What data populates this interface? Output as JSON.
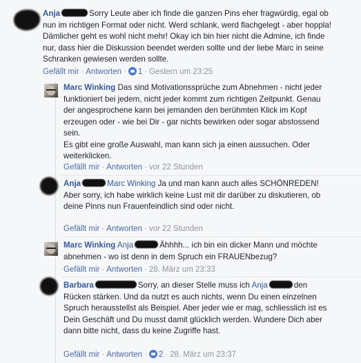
{
  "comments": [
    {
      "author": "Anja",
      "text": "Sorry Leute aber ich finde die ganzen Pins eher fragwürdig, egal ob nun im richtigen Format oder nicht. Werd schlank, werd flachgelegt - aber hoppla! Dämlicher geht es wohl nicht mehr! Okay ich bin hier nicht die Admine, ich finde nur, dass hier die Diskussion beendet werden sollte und der liebe Marc in seine Schranken gewiesen werden sollte.",
      "like": "Gefällt mir",
      "reply": "Antworten",
      "likes": "1",
      "time": "Gestern um 23:25"
    },
    {
      "author": "Marc Winking",
      "text": "Das sind Motivationssprüche zum Abnehmen - nicht jeder funktioniert bei jedem, nicht jeder kommt zum richtigen Zeitpunkt. Genau der angesprochene kann bei jemanden den berühmten Klick im Kopf erzeugen oder - wie bei Dir - gar nichts bewirken oder sogar abstossend sein.",
      "text2": "Es gibt eine große Auswahl, man kann sich ja einen aussuchen. Oder weiterklicken.",
      "like": "Gefällt mir",
      "reply": "Antworten",
      "time": "vor 22 Stunden"
    },
    {
      "author": "Anja",
      "mention": "Marc Winking",
      "text": "Ja und man kann auch alles SCHÖNREDEN! Aber sorry, ich habe wirklich keine Lust mit dir darüber zu diskutieren, ob deine Pinns nun Frauenfeindlich sind oder nicht.",
      "like": "Gefällt mir",
      "reply": "Antworten",
      "time": "vor 22 Stunden"
    },
    {
      "author": "Marc Winking",
      "mention": "Anja",
      "text": "Ähhhh... ich bin ein dicker Mann und möchte abnehmen - wo ist denn in dem Spruch ein FRAUENbezug?",
      "like": "Gefällt mir",
      "reply": "Antworten",
      "time": "28. März um 23:33"
    },
    {
      "author": "Barbara",
      "text_a": "Sorry, an dieser Stelle muss ich",
      "mention": "Anja",
      "text_b": "den Rücken stärken. Und da nutzt es auch nichts, wenn Du einen einzelnen Spruch herausstellst als Beispiel. Aber jeder wie er mag, schliesslich ist es Dein Geschäft und Du musst damit glücklich werden. Wundere Dich aber dann bitte nicht, dass du keine Zugriffe hast.",
      "like": "Gefällt mir",
      "reply": "Antworten",
      "likes": "2",
      "time": "28. März um 23:37"
    }
  ]
}
